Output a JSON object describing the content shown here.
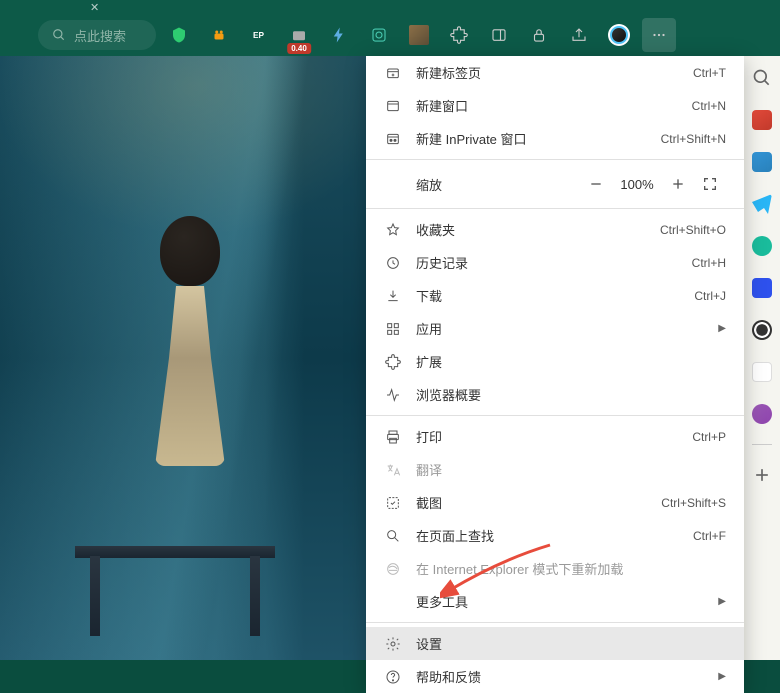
{
  "toolbar": {
    "search_placeholder": "点此搜索",
    "badge_value": "0.40"
  },
  "menu": {
    "items": [
      {
        "icon": "new-tab-icon",
        "label": "新建标签页",
        "shortcut": "Ctrl+T"
      },
      {
        "icon": "new-window-icon",
        "label": "新建窗口",
        "shortcut": "Ctrl+N"
      },
      {
        "icon": "inprivate-icon",
        "label": "新建 InPrivate 窗口",
        "shortcut": "Ctrl+Shift+N"
      }
    ],
    "zoom": {
      "label": "缩放",
      "value": "100%"
    },
    "items2": [
      {
        "icon": "favorites-icon",
        "label": "收藏夹",
        "shortcut": "Ctrl+Shift+O"
      },
      {
        "icon": "history-icon",
        "label": "历史记录",
        "shortcut": "Ctrl+H"
      },
      {
        "icon": "downloads-icon",
        "label": "下载",
        "shortcut": "Ctrl+J"
      },
      {
        "icon": "apps-icon",
        "label": "应用",
        "submenu": true
      },
      {
        "icon": "extensions-icon",
        "label": "扩展"
      },
      {
        "icon": "performance-icon",
        "label": "浏览器概要"
      }
    ],
    "items3": [
      {
        "icon": "print-icon",
        "label": "打印",
        "shortcut": "Ctrl+P"
      },
      {
        "icon": "translate-icon",
        "label": "翻译",
        "disabled": true
      },
      {
        "icon": "screenshot-icon",
        "label": "截图",
        "shortcut": "Ctrl+Shift+S"
      },
      {
        "icon": "find-icon",
        "label": "在页面上查找",
        "shortcut": "Ctrl+F"
      },
      {
        "icon": "ie-icon",
        "label": "在 Internet Explorer 模式下重新加载",
        "disabled": true
      },
      {
        "icon": "",
        "label": "更多工具",
        "submenu": true
      }
    ],
    "items4": [
      {
        "icon": "settings-icon",
        "label": "设置",
        "highlighted": true
      },
      {
        "icon": "help-icon",
        "label": "帮助和反馈",
        "submenu": true
      }
    ]
  },
  "sidebar_icons": [
    "search",
    "tool1",
    "tool2",
    "telegram",
    "wechat",
    "baidu",
    "qq",
    "app1",
    "app2"
  ]
}
